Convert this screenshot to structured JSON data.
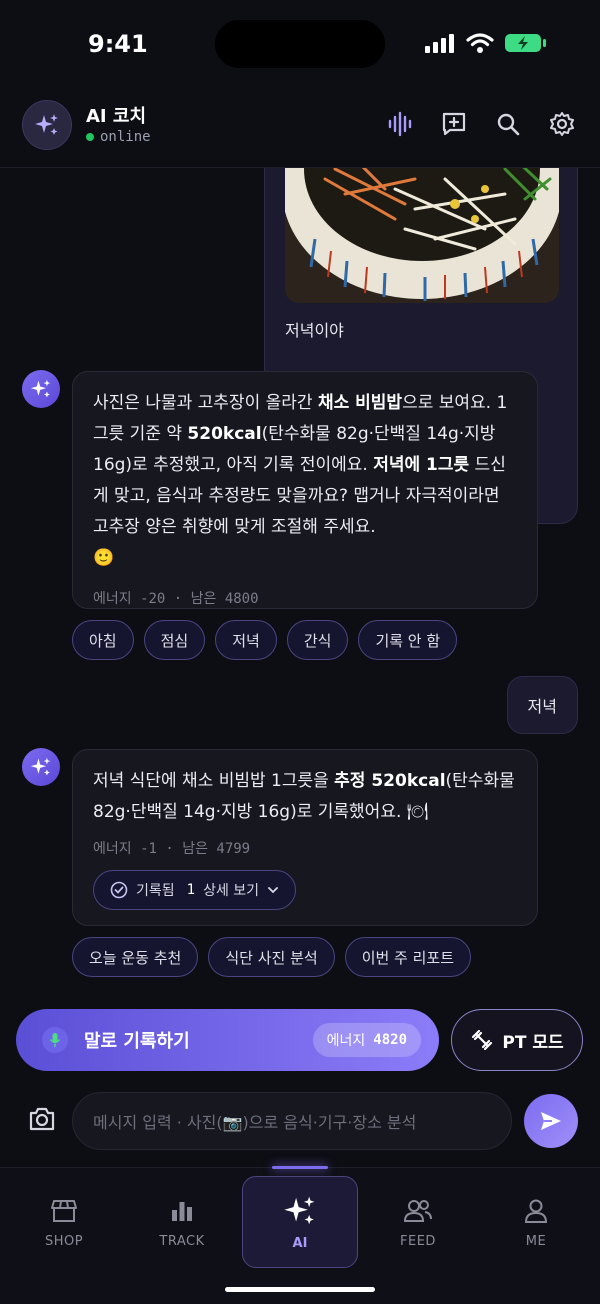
{
  "status_bar": {
    "time": "9:41"
  },
  "header": {
    "name": "AI 코치",
    "status": "online"
  },
  "messages": {
    "photo_caption": "저녁이야",
    "ai_1": {
      "t1": "사진은 나물과 고추장이 올라간 ",
      "b1": "채소 비빔밥",
      "t2": "으로 보여요. 1그릇 기준 약 ",
      "b2": "520kcal",
      "t3": "(탄수화물 82g·단백질 14g·지방 16g)로 추정했고, 아직 기록 전이에요. ",
      "b3": "저녁에 1그릇",
      "t4": " 드신 게 맞고, 음식과 추정량도 맞을까요? 맵거나 자극적이라면 고추장 양은 취향에 맞게 조절해 주세요.",
      "emoji": "🙂",
      "meta": "에너지 -20 · 남은 4800"
    },
    "meal_chips": [
      "아침",
      "점심",
      "저녁",
      "간식",
      "기록 안 함"
    ],
    "user_reply": "저녁",
    "ai_2": {
      "t1": "저녁 식단에 채소 비빔밥 1그릇을 ",
      "b1": "추정 520kcal",
      "t2": "(탄수화물 82g·단백질 14g·지방 16g)로 기록했어요. 🍽",
      "meta": "에너지 -1 · 남은 4799",
      "logged_label": "기록됨",
      "logged_count": "1",
      "detail_label": "상세 보기"
    },
    "suggestion_chips": [
      "오늘 운동 추천",
      "식단 사진 분석",
      "이번 주 리포트"
    ]
  },
  "actions": {
    "voice_label": "말로 기록하기",
    "energy_label": "에너지",
    "energy_value": "4820",
    "pt_label": "PT 모드"
  },
  "composer": {
    "placeholder": "메시지 입력 · 사진(📷)으로 음식·기구·장소 분석"
  },
  "tabs": {
    "shop": "SHOP",
    "track": "TRACK",
    "ai": "AI",
    "feed": "FEED",
    "me": "ME"
  },
  "colors": {
    "accent": "#7c6cf0",
    "online": "#22c55e",
    "battery": "#3ddc84"
  },
  "icons": [
    "sparkle-icon",
    "waveform-icon",
    "new-chat-icon",
    "search-icon",
    "gear-icon",
    "mic-icon",
    "dumbbell-icon",
    "camera-icon",
    "send-icon",
    "shop-icon",
    "chart-icon",
    "people-icon",
    "person-icon",
    "check-circle-icon",
    "chevron-down-icon"
  ]
}
